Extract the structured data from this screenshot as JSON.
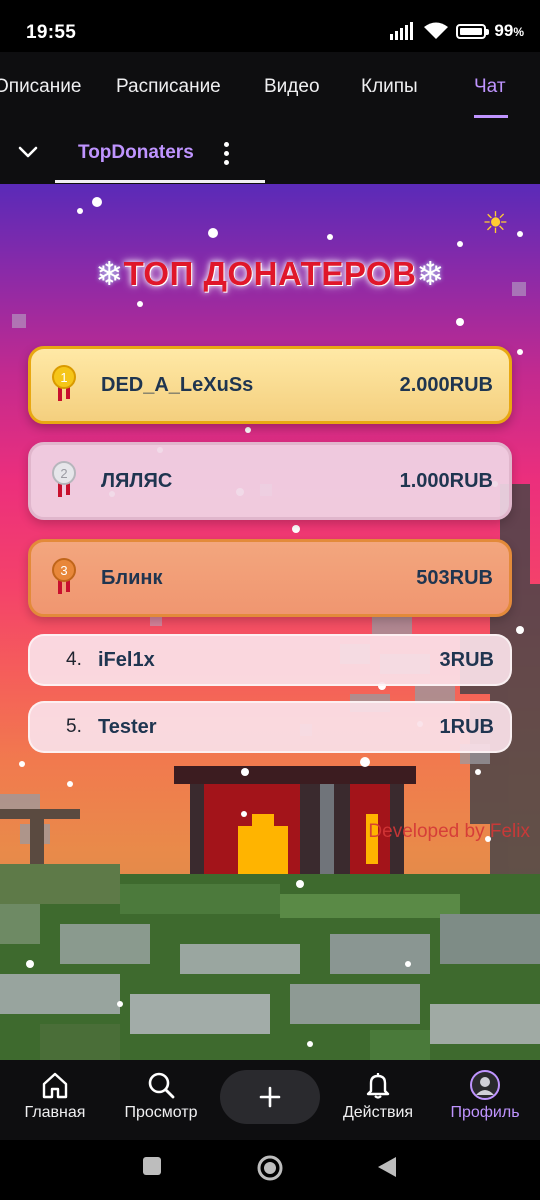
{
  "status_bar": {
    "time": "19:55",
    "battery": "99",
    "battery_unit": "%",
    "battery_level": 0.99
  },
  "top_tabs": [
    {
      "label": "Описание",
      "active": false
    },
    {
      "label": "Расписание",
      "active": false
    },
    {
      "label": "Видео",
      "active": false
    },
    {
      "label": "Клипы",
      "active": false
    },
    {
      "label": "Чат",
      "active": true
    }
  ],
  "panel_header": {
    "tab_label": "TopDonaters"
  },
  "panel": {
    "title": "ТОП ДОНАТЕРОВ",
    "title_decoration": "❄",
    "credit": "Developed by Felix",
    "donors": [
      {
        "rank": "1",
        "name": "DED_A_LeXuSs",
        "amount": "2.000RUB",
        "medal": "gold"
      },
      {
        "rank": "2",
        "name": "ЛЯЛЯС",
        "amount": "1.000RUB",
        "medal": "silver"
      },
      {
        "rank": "3",
        "name": "Блинк",
        "amount": "503RUB",
        "medal": "bronze"
      },
      {
        "rank": "4.",
        "name": "iFel1x",
        "amount": "3RUB"
      },
      {
        "rank": "5.",
        "name": "Tester",
        "amount": "1RUB"
      }
    ]
  },
  "bottom_nav": [
    {
      "label": "Главная",
      "icon": "home-icon",
      "active": false
    },
    {
      "label": "Просмотр",
      "icon": "search-icon",
      "active": false
    },
    {
      "label": "",
      "icon": "plus-icon",
      "active": false
    },
    {
      "label": "Действия",
      "icon": "bell-icon",
      "active": false
    },
    {
      "label": "Профиль",
      "icon": "profile-avatar",
      "active": true
    }
  ],
  "colors": {
    "accent": "#bf94ff",
    "title_red": "#e0172a",
    "gold": "#e8a812",
    "bronze": "#e38a3a"
  }
}
